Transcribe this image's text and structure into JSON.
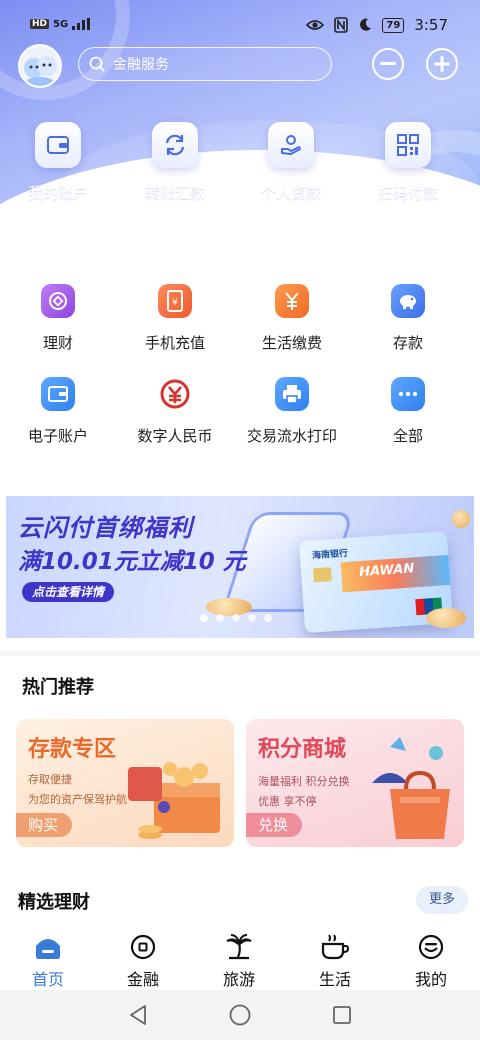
{
  "status_bar": {
    "network": "HD",
    "signal_label": "5G",
    "battery": "79",
    "time": "3:57",
    "icons": [
      "eye-icon",
      "nfc-icon",
      "moon-icon"
    ]
  },
  "header": {
    "search_placeholder": "金融服务",
    "quick_actions": [
      {
        "label": "我的账户",
        "icon": "wallet-icon"
      },
      {
        "label": "转账汇款",
        "icon": "transfer-cycle-icon"
      },
      {
        "label": "个人贷款",
        "icon": "loan-hand-icon"
      },
      {
        "label": "扫码付款",
        "icon": "qr-code-icon"
      }
    ]
  },
  "services": [
    {
      "label": "理财",
      "icon": "wealth-icon",
      "color": "#a45be8"
    },
    {
      "label": "手机充值",
      "icon": "phone-recharge-icon",
      "color": "#f36d3d"
    },
    {
      "label": "生活缴费",
      "icon": "yuan-payment-icon",
      "color": "#f57a35"
    },
    {
      "label": "存款",
      "icon": "piggy-bank-icon",
      "color": "#4b84ee"
    },
    {
      "label": "电子账户",
      "icon": "e-account-icon",
      "color": "#3f8ff0"
    },
    {
      "label": "数字人民币",
      "icon": "digital-rmb-icon",
      "color": "#d9342b"
    },
    {
      "label": "交易流水打印",
      "icon": "printer-icon",
      "color": "#3f8ff0"
    },
    {
      "label": "全部",
      "icon": "more-dots-icon",
      "color": "#3f8ff0"
    }
  ],
  "banner": {
    "title": "云闪付首绑福利",
    "subtitle": "满10.01元立减10 元",
    "button": "点击查看详情",
    "card_bank": "海南银行",
    "card_text": "HAWAN",
    "dot_count": 5,
    "active_dot": 0
  },
  "hot": {
    "title": "热门推荐",
    "cards": [
      {
        "title": "存款专区",
        "line1": "存取便捷",
        "line2": "为您的资产保驾护航",
        "button": "购买"
      },
      {
        "title": "积分商城",
        "line1": "海量福利 积分兑换",
        "line2": "优惠  享不停",
        "button": "兑换"
      }
    ]
  },
  "finance": {
    "title": "精选理财",
    "more": "更多"
  },
  "tabs": [
    {
      "label": "首页",
      "icon": "home-icon",
      "active": true
    },
    {
      "label": "金融",
      "icon": "finance-icon",
      "active": false
    },
    {
      "label": "旅游",
      "icon": "palm-tree-icon",
      "active": false
    },
    {
      "label": "生活",
      "icon": "coffee-cup-icon",
      "active": false
    },
    {
      "label": "我的",
      "icon": "smiley-face-icon",
      "active": false
    }
  ],
  "colors": {
    "accent": "#3c7ad8",
    "banner_text": "#3f35c9",
    "deposit_card": "#fde3cf",
    "points_card": "#fbdfe2"
  }
}
